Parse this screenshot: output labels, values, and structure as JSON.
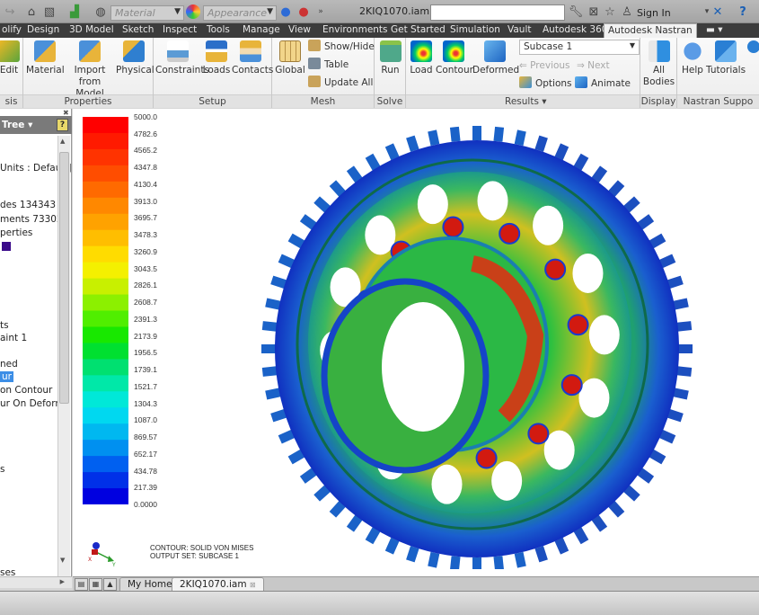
{
  "quick_access": {
    "material_placeholder": "Material",
    "appearance_placeholder": "Appearance",
    "document_title": "2KIQ1070.iam ...",
    "search_value": "",
    "sign_in": "Sign In"
  },
  "ribbon_tabs": [
    {
      "label": "olify"
    },
    {
      "label": "Design"
    },
    {
      "label": "3D Model"
    },
    {
      "label": "Sketch"
    },
    {
      "label": "Inspect"
    },
    {
      "label": "Tools"
    },
    {
      "label": "Manage"
    },
    {
      "label": "View"
    },
    {
      "label": "Environments"
    },
    {
      "label": "Get Started"
    },
    {
      "label": "Simulation"
    },
    {
      "label": "Vault"
    },
    {
      "label": "Autodesk 360"
    },
    {
      "label": "Autodesk Nastran",
      "active": true
    }
  ],
  "ribbon": {
    "analysis": {
      "label": "sis",
      "edit": "Edit"
    },
    "properties": {
      "label": "Properties",
      "material": "Material",
      "import_line1": "Import from",
      "import_line2": "Model",
      "physical": "Physical"
    },
    "setup": {
      "label": "Setup",
      "constraints": "Constraints",
      "loads": "Loads",
      "contacts": "Contacts"
    },
    "mesh": {
      "label": "Mesh",
      "global": "Global",
      "show_hide": "Show/Hide",
      "table": "Table",
      "update_all": "Update  All"
    },
    "solve": {
      "label": "Solve",
      "run": "Run"
    },
    "results": {
      "label": "Results ▾",
      "load": "Load",
      "contour": "Contour",
      "deformed": "Deformed",
      "subcase": "Subcase 1",
      "previous": "Previous",
      "next": "Next",
      "options": "Options",
      "animate": "Animate"
    },
    "display": {
      "label": "Display",
      "all_line1": "All",
      "all_line2": "Bodies"
    },
    "support": {
      "label": "Nastran Suppo",
      "help": "Help",
      "tutorials": "Tutorials"
    }
  },
  "browser": {
    "header": "Tree ▾",
    "help": "?",
    "items": [
      {
        "text": "Units : Default]"
      },
      {
        "text": "des 134343"
      },
      {
        "text": "ments 73302"
      },
      {
        "text": "perties"
      },
      {
        "text": "ts"
      },
      {
        "text": "aint 1"
      },
      {
        "text": "ned"
      },
      {
        "text": "ur",
        "selected": true
      },
      {
        "text": "on Contour"
      },
      {
        "text": "ur On Deforme"
      },
      {
        "text": "s"
      },
      {
        "text": "ses"
      }
    ]
  },
  "legend": {
    "values": [
      "5000.0",
      "4782.6",
      "4565.2",
      "4347.8",
      "4130.4",
      "3913.0",
      "3695.7",
      "3478.3",
      "3260.9",
      "3043.5",
      "2826.1",
      "2608.7",
      "2391.3",
      "2173.9",
      "1956.5",
      "1739.1",
      "1521.7",
      "1304.3",
      "1087.0",
      "869.57",
      "652.17",
      "434.78",
      "217.39",
      "0.0000"
    ],
    "colors": [
      "#ff0000",
      "#ff1a00",
      "#ff3300",
      "#ff4d00",
      "#ff6a00",
      "#ff8800",
      "#ffa200",
      "#ffbe00",
      "#ffdc00",
      "#f4f000",
      "#c8f000",
      "#8cf000",
      "#50ee00",
      "#18e800",
      "#00e030",
      "#00e070",
      "#00e8a8",
      "#00e8d8",
      "#00d8f0",
      "#00b8f0",
      "#0090f0",
      "#0060f0",
      "#0030e8",
      "#0000e0"
    ]
  },
  "viewport": {
    "caption_line1": "CONTOUR: SOLID VON MISES",
    "caption_line2": "OUTPUT SET: SUBCASE 1",
    "triad_x": "X",
    "triad_y": "Y"
  },
  "doc_tabs": [
    {
      "label": "My Home"
    },
    {
      "label": "2KIQ1070.iam",
      "active": true
    }
  ]
}
